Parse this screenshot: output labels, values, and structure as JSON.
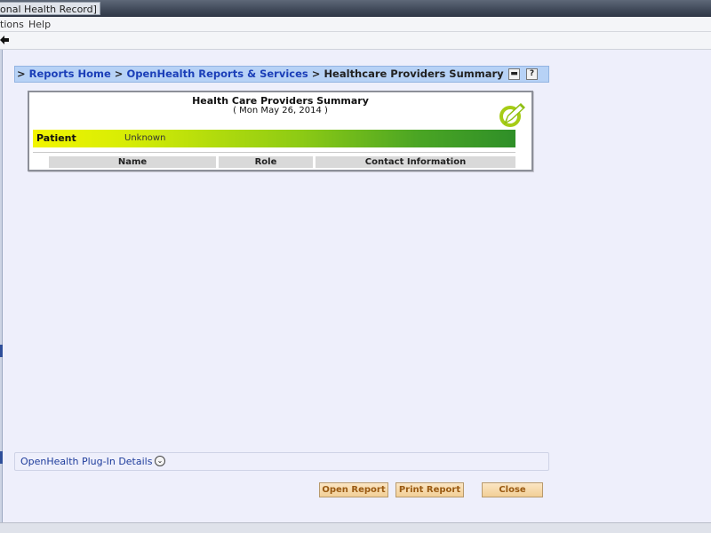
{
  "window": {
    "title": "onal Health Record]"
  },
  "menu": {
    "items": [
      "tions",
      "Help"
    ]
  },
  "breadcrumb": {
    "prefix": ">",
    "items": [
      {
        "label": "Reports Home",
        "link": true
      },
      {
        "label": "OpenHealth Reports & Services",
        "link": true
      },
      {
        "label": "Healthcare Providers Summary",
        "link": false
      }
    ],
    "separator": ">",
    "collapse_btn": "▬",
    "help_btn": "?"
  },
  "report": {
    "title": "Health Care Providers Summary",
    "date": "( Mon May 26, 2014 )",
    "patient_label": "Patient",
    "patient_value": "Unknown",
    "columns": [
      "Name",
      "Role",
      "Contact Information"
    ]
  },
  "plugin": {
    "label": "OpenHealth Plug-In Details",
    "toggle": "⌄"
  },
  "buttons": {
    "open": "Open Report",
    "print": "Print Report",
    "close": "Close"
  },
  "icons": {
    "back": "back-arrow-icon",
    "logo": "leaf-edit-icon"
  },
  "colors": {
    "accent_link": "#1b3fb8",
    "bar_start": "#f2f500",
    "bar_end": "#2f8f28",
    "button_text": "#9a5a12"
  }
}
